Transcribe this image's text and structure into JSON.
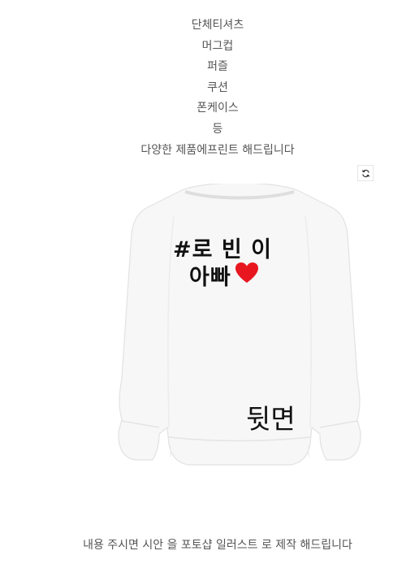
{
  "product_list": [
    "단체티셔츠",
    "머그컵",
    "퍼즐",
    "쿠션",
    "폰케이스",
    "등",
    "다양한 제품에프린트 해드립니다"
  ],
  "image": {
    "print_line1": "#로 빈 이",
    "print_line2": "아빠",
    "side_label": "뒷면",
    "heart_color": "#e8171f",
    "shirt_color": "#f7f7f7"
  },
  "icons": {
    "refresh": "refresh-icon"
  },
  "footer_note": "내용 주시면 시안 을 포토샵 일러스트 로 제작 해드립니다"
}
